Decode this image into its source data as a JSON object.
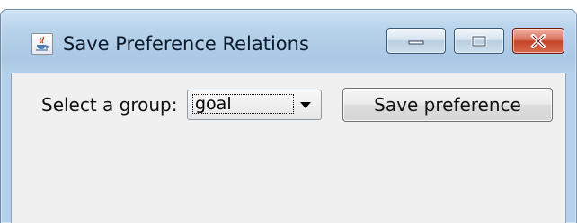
{
  "window": {
    "title": "Save Preference Relations",
    "icon": "java-app-icon",
    "caption_buttons": [
      "minimize-icon",
      "maximize-icon",
      "close-icon"
    ]
  },
  "form": {
    "group_label": "Select a group:",
    "group_select": {
      "value": "goal"
    },
    "save_button_label": "Save preference"
  },
  "colors": {
    "frame": "#b5d0ea",
    "client": "#f0f0f0",
    "close_button": "#c34427"
  }
}
